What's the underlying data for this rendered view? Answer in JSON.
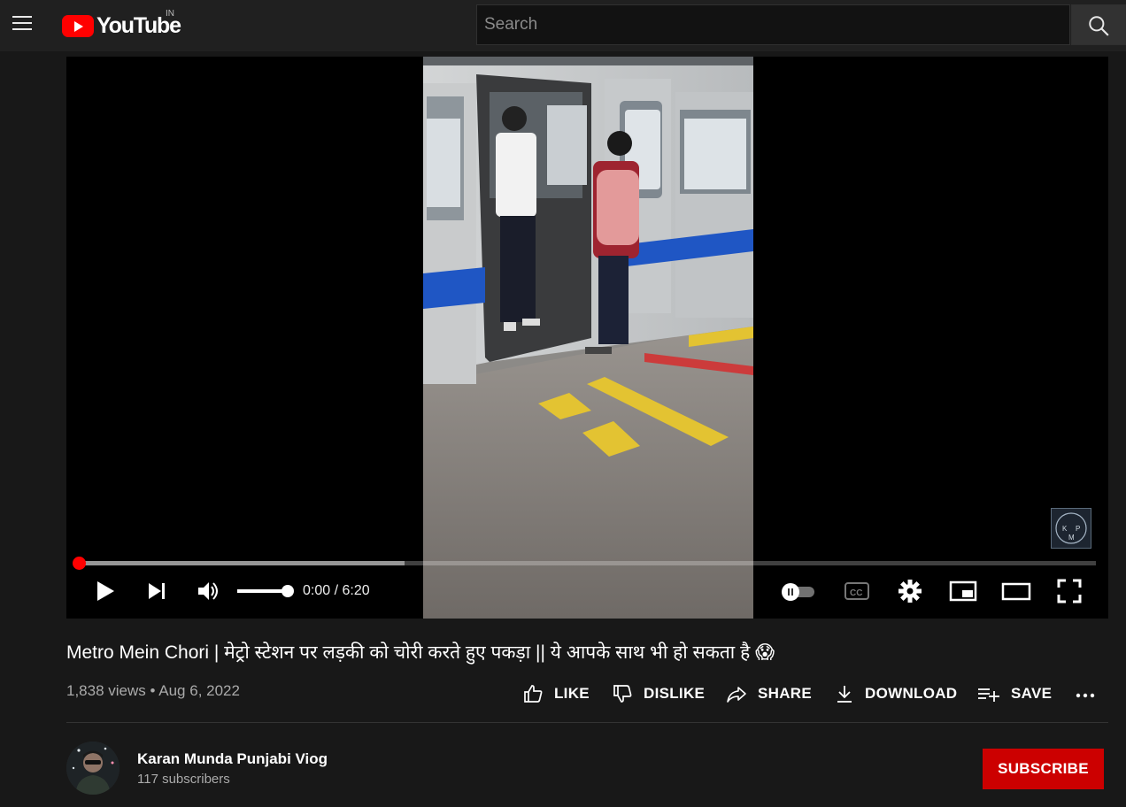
{
  "masthead": {
    "logo_text": "YouTube",
    "country_code": "IN",
    "search_placeholder": "Search"
  },
  "player": {
    "current_time": "0:00",
    "duration": "6:20",
    "time_display": "0:00 / 6:20",
    "progress_fraction": 0.0,
    "buffered_fraction": 0.32,
    "volume_fraction": 1.0,
    "watermark_letters": [
      "K",
      "P",
      "M"
    ]
  },
  "video": {
    "title": "Metro Mein Chori | मेट्रो स्टेशन पर लड़की को चोरी करते हुए पकड़ा || ये आपके साथ भी हो सकता है 😱",
    "views": "1,838 views",
    "separator": "•",
    "date": "Aug 6, 2022"
  },
  "actions": {
    "like": "LIKE",
    "dislike": "DISLIKE",
    "share": "SHARE",
    "download": "DOWNLOAD",
    "save": "SAVE"
  },
  "channel": {
    "name": "Karan Munda Punjabi Viog",
    "subscribers": "117 subscribers",
    "subscribe_label": "SUBSCRIBE"
  },
  "colors": {
    "brand_red": "#ff0000",
    "subscribe_red": "#cc0000",
    "background": "#181818",
    "masthead": "#202020"
  },
  "icons": [
    "menu-icon",
    "youtube-logo-icon",
    "search-icon",
    "play-icon",
    "next-icon",
    "volume-icon",
    "autoplay-toggle-icon",
    "captions-icon",
    "settings-icon",
    "miniplayer-icon",
    "theater-icon",
    "fullscreen-icon",
    "thumbs-up-icon",
    "thumbs-down-icon",
    "share-icon",
    "download-icon",
    "playlist-add-icon",
    "more-icon"
  ]
}
